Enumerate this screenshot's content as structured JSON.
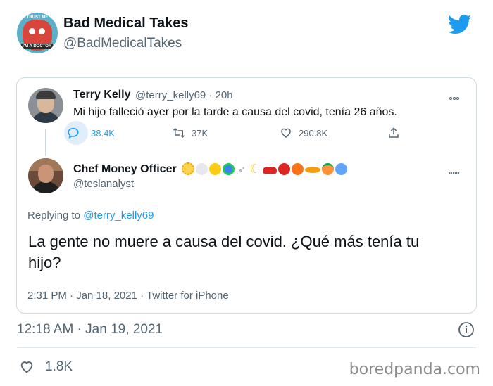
{
  "outer_tweet": {
    "name": "Bad Medical Takes",
    "handle": "@BadMedicalTakes",
    "avatar_text_top": "TRUST ME",
    "avatar_text_bottom": "I'M A DOCTOR",
    "timestamp": "12:18 AM · Jan 19, 2021",
    "likes": "1.8K"
  },
  "original_tweet": {
    "name": "Terry Kelly",
    "meta": "@terry_kelly69 · 20h",
    "text": "Mi hijo falleció ayer por la tarde a causa del covid, tenía 26 años.",
    "replies": "38.4K",
    "retweets": "37K",
    "likes": "290.8K"
  },
  "reply_tweet": {
    "name": "Chef Money Officer",
    "handle": "@teslanalyst",
    "replying_prefix": "Replying to ",
    "replying_to": "@terry_kelly69",
    "text": "La gente no muere a causa del covid. ¿Qué más tenía tu hijo?",
    "timestamp": "2:31 PM · Jan 18, 2021 · Twitter for iPhone",
    "emojis": [
      "sun",
      "white-circle",
      "yellow-circle",
      "earth",
      "rocket",
      "moon",
      "car",
      "red-circle",
      "orange-circle",
      "saturn",
      "peach",
      "cold-face"
    ]
  },
  "watermark": "boredpanda.com",
  "colors": {
    "accent": "#1d9bf0",
    "muted": "#536471",
    "border": "#cfd9de"
  }
}
